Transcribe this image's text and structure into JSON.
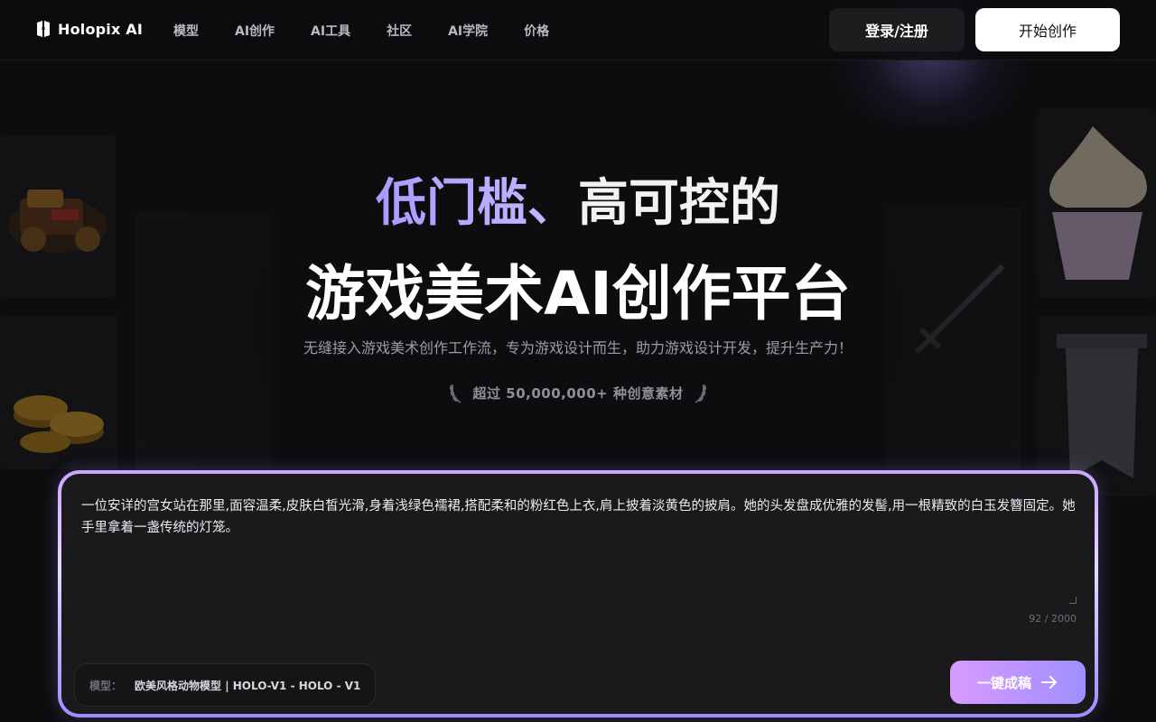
{
  "brand": {
    "name": "Holopix AI"
  },
  "nav": {
    "items": [
      {
        "label": "模型"
      },
      {
        "label": "AI创作"
      },
      {
        "label": "AI工具"
      },
      {
        "label": "社区"
      },
      {
        "label": "AI学院"
      },
      {
        "label": "价格"
      }
    ]
  },
  "header": {
    "login_label": "登录/注册",
    "start_label": "开始创作"
  },
  "hero": {
    "headline_accent": "低门槛、",
    "headline_plain": "高可控的",
    "headline2": "游戏美术AI创作平台",
    "subtitle": "无缝接入游戏美术创作工作流，专为游戏设计而生，助力游戏设计开发，提升生产力！",
    "stat": "超过 50,000,000+ 种创意素材"
  },
  "prompt": {
    "value": "一位安详的宫女站在那里,面容温柔,皮肤白皙光滑,身着浅绿色襦裙,搭配柔和的粉红色上衣,肩上披着淡黄色的披肩。她的头发盘成优雅的发髻,用一根精致的白玉发簪固定。她手里拿着一盏传统的灯笼。",
    "counter": "92 / 2000",
    "model_label": "模型：",
    "model_value": "欧美风格动物模型 | HOLO-V1  -  HOLO - V1",
    "generate_label": "一键成稿"
  },
  "colors": {
    "accent": "#a89bff",
    "button_gradient_start": "#d89aff",
    "button_gradient_end": "#9f8fff"
  }
}
